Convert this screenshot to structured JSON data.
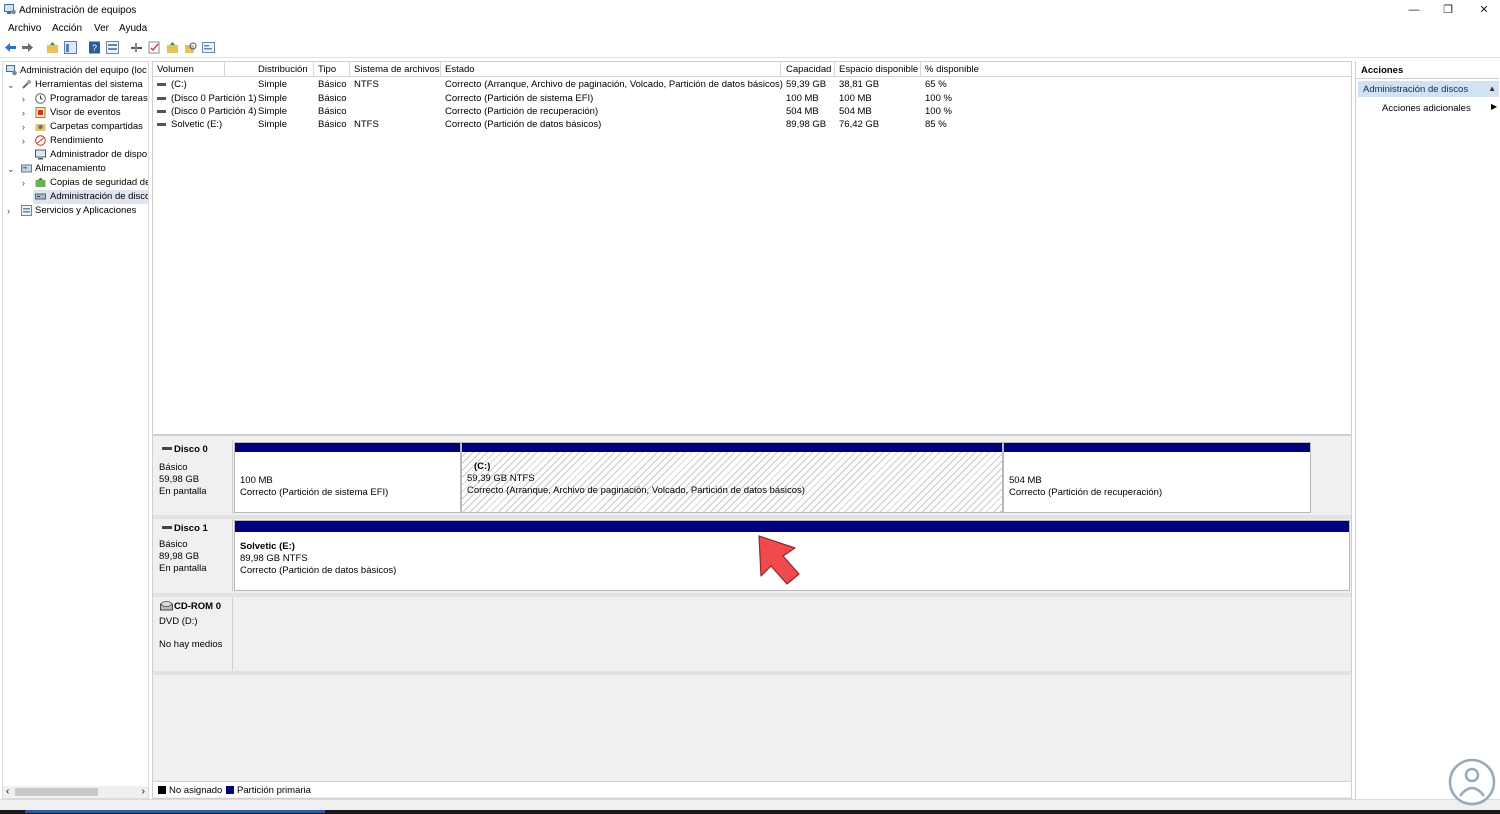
{
  "window": {
    "title": "Administración de equipos",
    "minimize_glyph": "—",
    "restore_glyph": "❐",
    "close_glyph": "✕"
  },
  "menu": {
    "items": [
      "Archivo",
      "Acción",
      "Ver",
      "Ayuda"
    ]
  },
  "toolbar": {
    "icons": [
      "back-icon",
      "forward-icon",
      "up-folder-icon",
      "show-tree-icon",
      "help-icon",
      "properties-icon",
      "connect-icon",
      "check-icon",
      "new-icon",
      "search-folder-icon",
      "console-icon"
    ]
  },
  "tree": {
    "items": [
      {
        "label": "Administración del equipo (loc",
        "icon": "computer-management-icon",
        "expander": ""
      },
      {
        "label": "Herramientas del sistema",
        "icon": "tools-icon",
        "expander": "⌄"
      },
      {
        "label": "Programador de tareas",
        "icon": "clock-icon",
        "expander": "›"
      },
      {
        "label": "Visor de eventos",
        "icon": "event-viewer-icon",
        "expander": "›"
      },
      {
        "label": "Carpetas compartidas",
        "icon": "shared-folder-icon",
        "expander": "›"
      },
      {
        "label": "Rendimiento",
        "icon": "performance-icon",
        "expander": "›"
      },
      {
        "label": "Administrador de dispo",
        "icon": "device-manager-icon",
        "expander": ""
      },
      {
        "label": "Almacenamiento",
        "icon": "storage-icon",
        "expander": "⌄"
      },
      {
        "label": "Copias de seguridad de",
        "icon": "backup-icon",
        "expander": "›"
      },
      {
        "label": "Administración de disco",
        "icon": "disk-management-icon",
        "expander": ""
      },
      {
        "label": "Servicios y Aplicaciones",
        "icon": "services-icon",
        "expander": "›"
      }
    ],
    "scroll_left": "‹",
    "scroll_right": "›"
  },
  "volumes": {
    "columns": [
      "Volumen",
      "Distribución",
      "Tipo",
      "Sistema de archivos",
      "Estado",
      "Capacidad",
      "Espacio disponible",
      "% disponible"
    ],
    "rows": [
      [
        "(C:)",
        "Simple",
        "Básico",
        "NTFS",
        "Correcto (Arranque, Archivo de paginación, Volcado, Partición de datos básicos)",
        "59,39 GB",
        "38,81 GB",
        "65 %"
      ],
      [
        "(Disco 0 Partición 1)",
        "Simple",
        "Básico",
        "",
        "Correcto (Partición de sistema EFI)",
        "100 MB",
        "100 MB",
        "100 %"
      ],
      [
        "(Disco 0 Partición 4)",
        "Simple",
        "Básico",
        "",
        "Correcto (Partición de recuperación)",
        "504 MB",
        "504 MB",
        "100 %"
      ],
      [
        "Solvetic (E:)",
        "Simple",
        "Básico",
        "NTFS",
        "Correcto (Partición de datos básicos)",
        "89,98 GB",
        "76,42 GB",
        "85 %"
      ]
    ]
  },
  "disks": [
    {
      "name": "Disco 0",
      "lines": [
        "Básico",
        "59,98 GB",
        "En pantalla"
      ],
      "partitions": [
        {
          "title": "",
          "lines": [
            "100 MB",
            "Correcto (Partición de sistema EFI)"
          ]
        },
        {
          "title": "(C:)",
          "lines": [
            "59,39 GB NTFS",
            "Correcto (Arranque, Archivo de paginación, Volcado, Partición de datos básicos)"
          ]
        },
        {
          "title": "",
          "lines": [
            "504 MB",
            "Correcto (Partición de recuperación)"
          ]
        }
      ]
    },
    {
      "name": "Disco 1",
      "lines": [
        "Básico",
        "89,98 GB",
        "En pantalla"
      ],
      "partitions": [
        {
          "title": "Solvetic  (E:)",
          "lines": [
            "89,98 GB NTFS",
            "Correcto (Partición de datos básicos)"
          ]
        }
      ]
    },
    {
      "name": "CD-ROM 0",
      "lines": [
        "DVD (D:)",
        "No hay medios"
      ],
      "partitions": []
    }
  ],
  "legend": [
    {
      "label": "No asignado",
      "color": "#000000"
    },
    {
      "label": "Partición primaria",
      "color": "#00007f"
    }
  ],
  "actions": {
    "header": "Acciones",
    "selected": "Administración de discos",
    "more": "Acciones adicionales"
  },
  "colors": {
    "partition_bar": "#00007f",
    "selection": "#d2e2f3",
    "annotation_arrow": "#f04a4f"
  }
}
